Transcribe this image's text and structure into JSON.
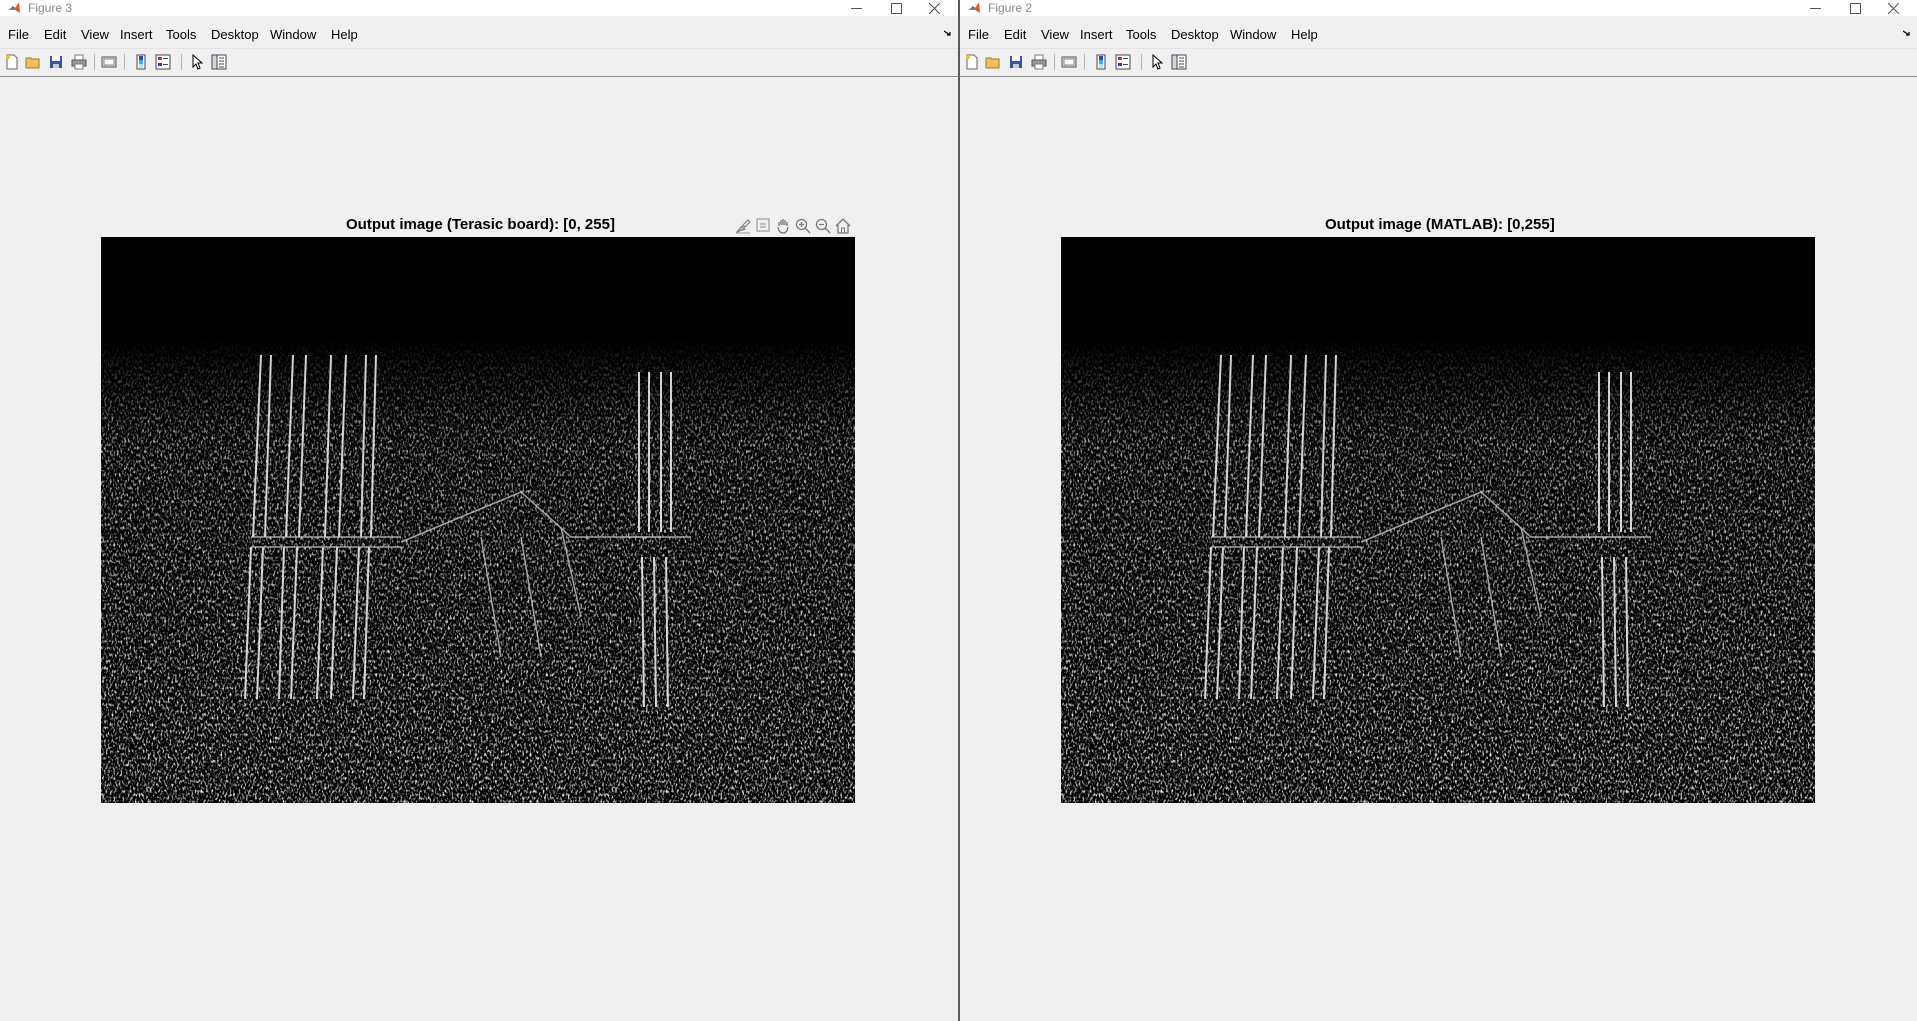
{
  "windows": [
    {
      "id": "left",
      "title": "Figure 3",
      "axes_title": "Output image (Terasic board): [0, 255]",
      "show_axes_toolbar": true
    },
    {
      "id": "right",
      "title": "Figure 2",
      "axes_title": "Output image (MATLAB): [0,255]",
      "show_axes_toolbar": false
    }
  ],
  "menu": [
    "File",
    "Edit",
    "View",
    "Insert",
    "Tools",
    "Desktop",
    "Window",
    "Help"
  ],
  "toolbar_icons": [
    "new-figure-icon",
    "open-file-icon",
    "save-icon",
    "print-icon",
    "link-plot-icon",
    "insert-colorbar-icon",
    "insert-legend-icon",
    "edit-plot-pointer-icon",
    "property-inspector-icon"
  ],
  "axes_toolbar_icons": [
    "brush-icon",
    "data-tips-icon",
    "pan-hand-icon",
    "zoom-in-icon",
    "zoom-out-icon",
    "home-restore-view-icon"
  ],
  "colors": {
    "window_bg": "#f0f0f0",
    "plot_bg": "#000000",
    "divider": "#5a5a5a"
  }
}
